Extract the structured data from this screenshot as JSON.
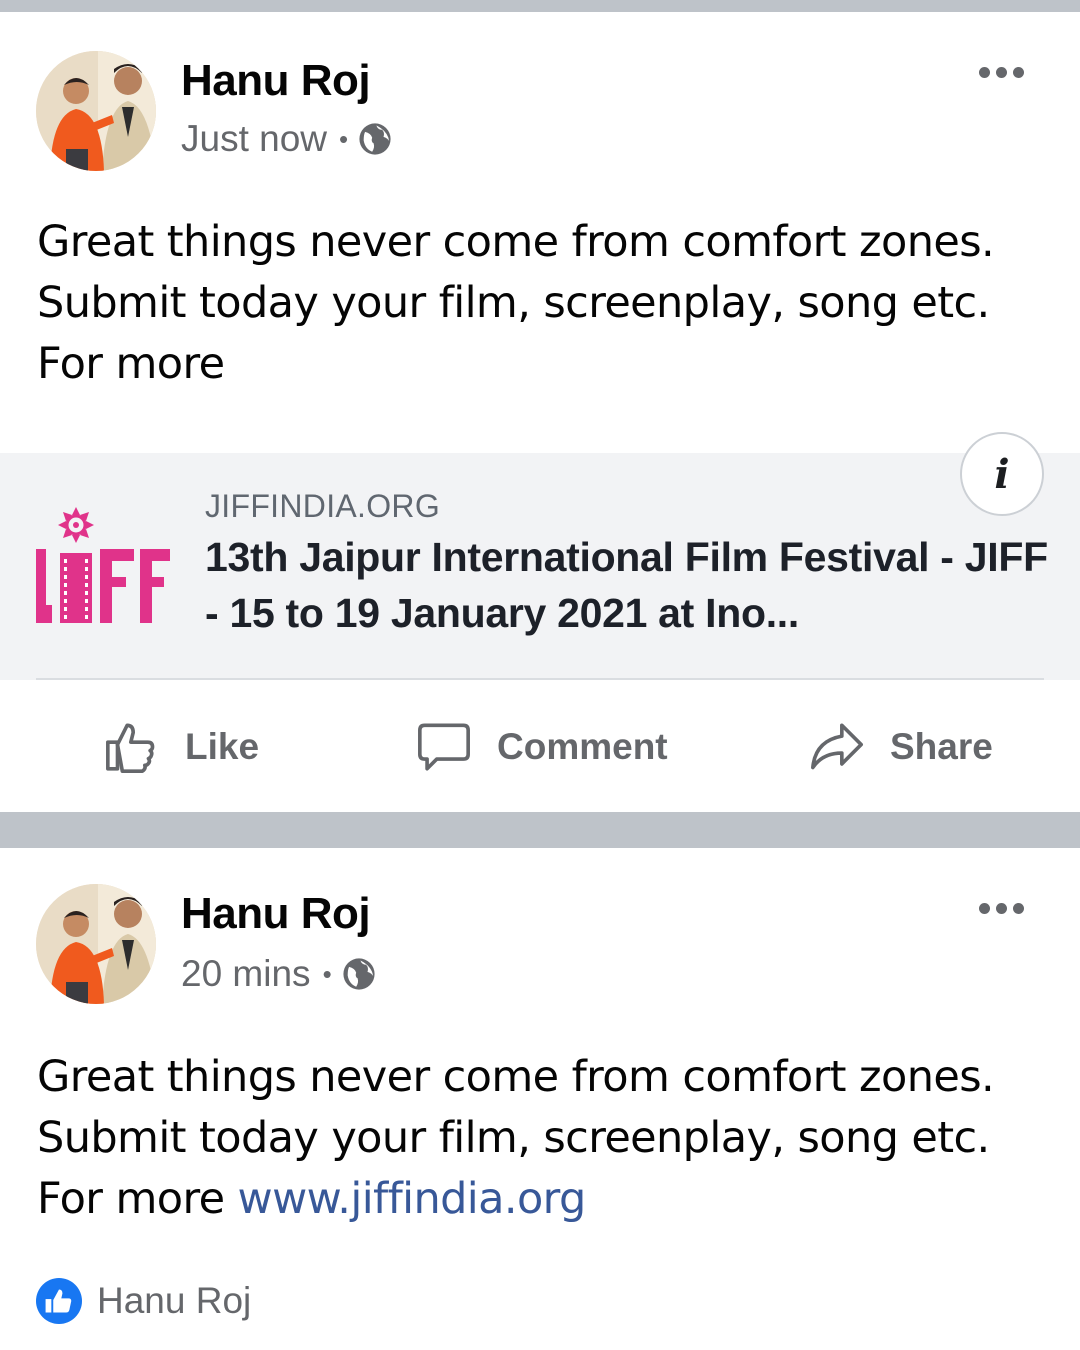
{
  "posts": [
    {
      "author": "Hanu Roj",
      "time": "Just now",
      "separator": "•",
      "text_lines": [
        "Great things never come from comfort zones.",
        "Submit today your film, screenplay, song etc.",
        "For more"
      ],
      "link_preview": {
        "domain": "JIFFINDIA.ORG",
        "title": "13th Jaipur International Film Festival - JIFF - 15 to 19 January 2021 at Ino...",
        "logo_text": "jiff",
        "info_label": "i"
      },
      "actions": {
        "like": "Like",
        "comment": "Comment",
        "share": "Share"
      }
    },
    {
      "author": "Hanu Roj",
      "time": "20 mins",
      "separator": "•",
      "text_lines": [
        "Great things never come from comfort zones.",
        "Submit today your film, screenplay, song etc.",
        "For more "
      ],
      "link_text": "www.jiffindia.org",
      "reactions": {
        "names": "Hanu Roj"
      }
    }
  ],
  "colors": {
    "feed_separator": "#bec3c9",
    "link": "#385898",
    "secondary_text": "#65676b",
    "like_blue": "#1877f2",
    "logo_pink": "#e0338a"
  },
  "icons": {
    "privacy": "globe-icon",
    "more": "more-dots-icon",
    "like": "thumbs-up-icon",
    "comment": "comment-bubble-icon",
    "share": "share-arrow-icon",
    "info": "info-icon",
    "reaction": "like-reaction-icon"
  }
}
